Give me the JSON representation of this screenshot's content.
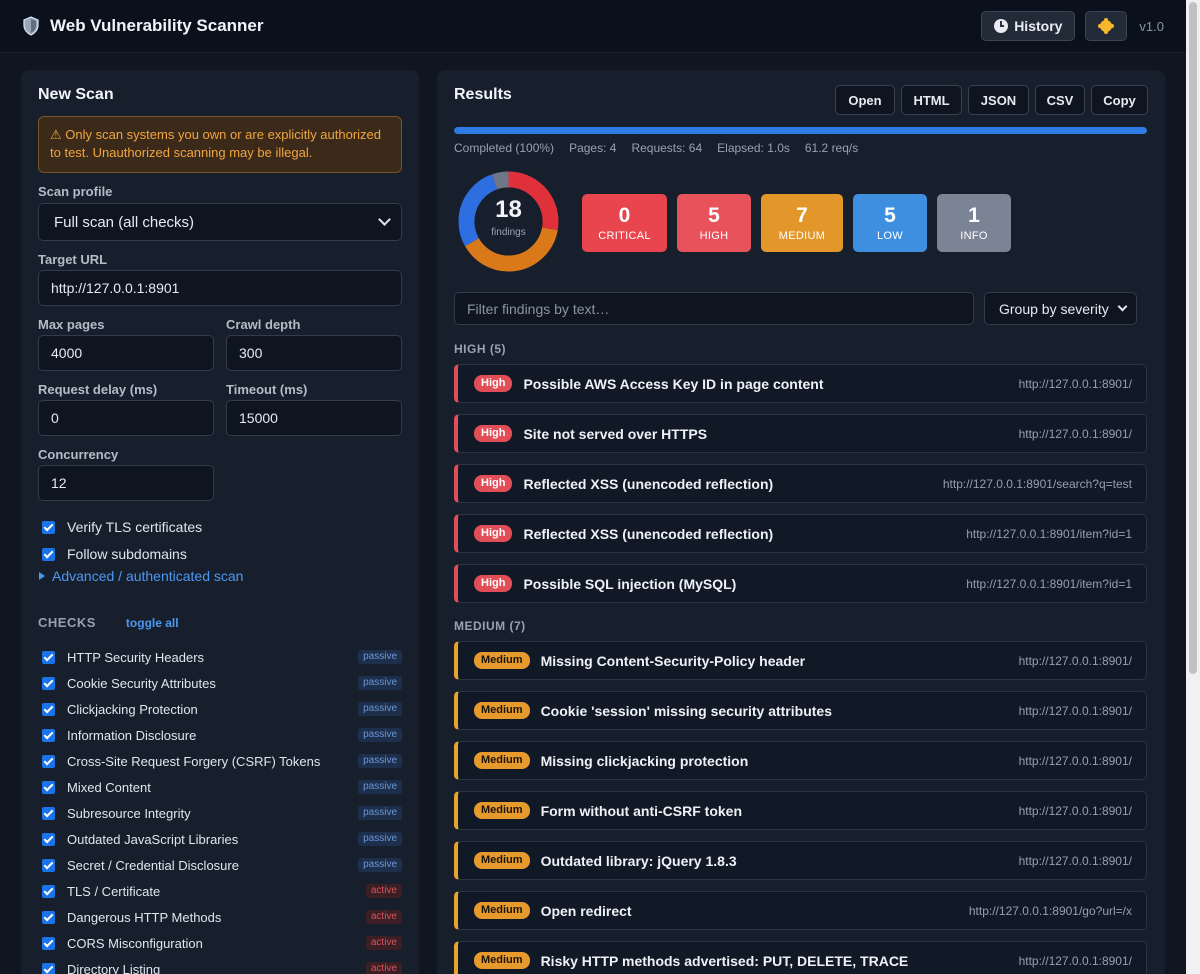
{
  "header": {
    "title": "Web Vulnerability Scanner",
    "history_label": "History",
    "version": "v1.0"
  },
  "scan": {
    "title": "New Scan",
    "warning": "⚠ Only scan systems you own or are explicitly authorized to test. Unauthorized scanning may be illegal.",
    "profile_label": "Scan profile",
    "profile_value": "Full scan (all checks)",
    "target_label": "Target URL",
    "target_value": "http://127.0.0.1:8901",
    "max_pages_label": "Max pages",
    "max_pages_value": "4000",
    "crawl_depth_label": "Crawl depth",
    "crawl_depth_value": "300",
    "delay_label": "Request delay (ms)",
    "delay_value": "0",
    "timeout_label": "Timeout (ms)",
    "timeout_value": "15000",
    "concurrency_label": "Concurrency",
    "concurrency_value": "12",
    "verify_tls_label": "Verify TLS certificates",
    "follow_sub_label": "Follow subdomains",
    "advanced_label": "Advanced / authenticated scan"
  },
  "checks": {
    "title": "CHECKS",
    "toggle_all": "toggle all",
    "items": [
      {
        "label": "HTTP Security Headers",
        "tag": "passive"
      },
      {
        "label": "Cookie Security Attributes",
        "tag": "passive"
      },
      {
        "label": "Clickjacking Protection",
        "tag": "passive"
      },
      {
        "label": "Information Disclosure",
        "tag": "passive"
      },
      {
        "label": "Cross-Site Request Forgery (CSRF) Tokens",
        "tag": "passive"
      },
      {
        "label": "Mixed Content",
        "tag": "passive"
      },
      {
        "label": "Subresource Integrity",
        "tag": "passive"
      },
      {
        "label": "Outdated JavaScript Libraries",
        "tag": "passive"
      },
      {
        "label": "Secret / Credential Disclosure",
        "tag": "passive"
      },
      {
        "label": "TLS / Certificate",
        "tag": "active"
      },
      {
        "label": "Dangerous HTTP Methods",
        "tag": "active"
      },
      {
        "label": "CORS Misconfiguration",
        "tag": "active"
      },
      {
        "label": "Directory Listing",
        "tag": "active"
      }
    ]
  },
  "results": {
    "title": "Results",
    "exports": [
      "Open",
      "HTML",
      "JSON",
      "CSV",
      "Copy"
    ],
    "progress": 1.0,
    "status": "Completed (100%)",
    "pages": "Pages: 4",
    "requests": "Requests: 64",
    "elapsed": "Elapsed: 1.0s",
    "rate": "61.2 req/s",
    "total": "18",
    "total_label": "findings",
    "severity": [
      {
        "label": "CRITICAL",
        "count": "0",
        "color": "#e8454f"
      },
      {
        "label": "HIGH",
        "count": "5",
        "color": "#e8525b"
      },
      {
        "label": "MEDIUM",
        "count": "7",
        "color": "#e3962a"
      },
      {
        "label": "LOW",
        "count": "5",
        "color": "#3f8fe0"
      },
      {
        "label": "INFO",
        "count": "1",
        "color": "#7a8494"
      }
    ],
    "filter_placeholder": "Filter findings by text…",
    "group_by": "Group by severity",
    "high_head": "HIGH (5)",
    "medium_head": "MEDIUM (7)",
    "high": [
      {
        "badge": "High",
        "title": "Possible AWS Access Key ID in page content",
        "url": "http://127.0.0.1:8901/"
      },
      {
        "badge": "High",
        "title": "Site not served over HTTPS",
        "url": "http://127.0.0.1:8901/"
      },
      {
        "badge": "High",
        "title": "Reflected XSS (unencoded reflection)",
        "url": "http://127.0.0.1:8901/search?q=test"
      },
      {
        "badge": "High",
        "title": "Reflected XSS (unencoded reflection)",
        "url": "http://127.0.0.1:8901/item?id=1"
      },
      {
        "badge": "High",
        "title": "Possible SQL injection (MySQL)",
        "url": "http://127.0.0.1:8901/item?id=1"
      }
    ],
    "medium": [
      {
        "badge": "Medium",
        "title": "Missing Content-Security-Policy header",
        "url": "http://127.0.0.1:8901/"
      },
      {
        "badge": "Medium",
        "title": "Cookie 'session' missing security attributes",
        "url": "http://127.0.0.1:8901/"
      },
      {
        "badge": "Medium",
        "title": "Missing clickjacking protection",
        "url": "http://127.0.0.1:8901/"
      },
      {
        "badge": "Medium",
        "title": "Form without anti-CSRF token",
        "url": "http://127.0.0.1:8901/"
      },
      {
        "badge": "Medium",
        "title": "Outdated library: jQuery 1.8.3",
        "url": "http://127.0.0.1:8901/"
      },
      {
        "badge": "Medium",
        "title": "Open redirect",
        "url": "http://127.0.0.1:8901/go?url=/x"
      },
      {
        "badge": "Medium",
        "title": "Risky HTTP methods advertised: PUT, DELETE, TRACE",
        "url": "http://127.0.0.1:8901/"
      }
    ]
  }
}
